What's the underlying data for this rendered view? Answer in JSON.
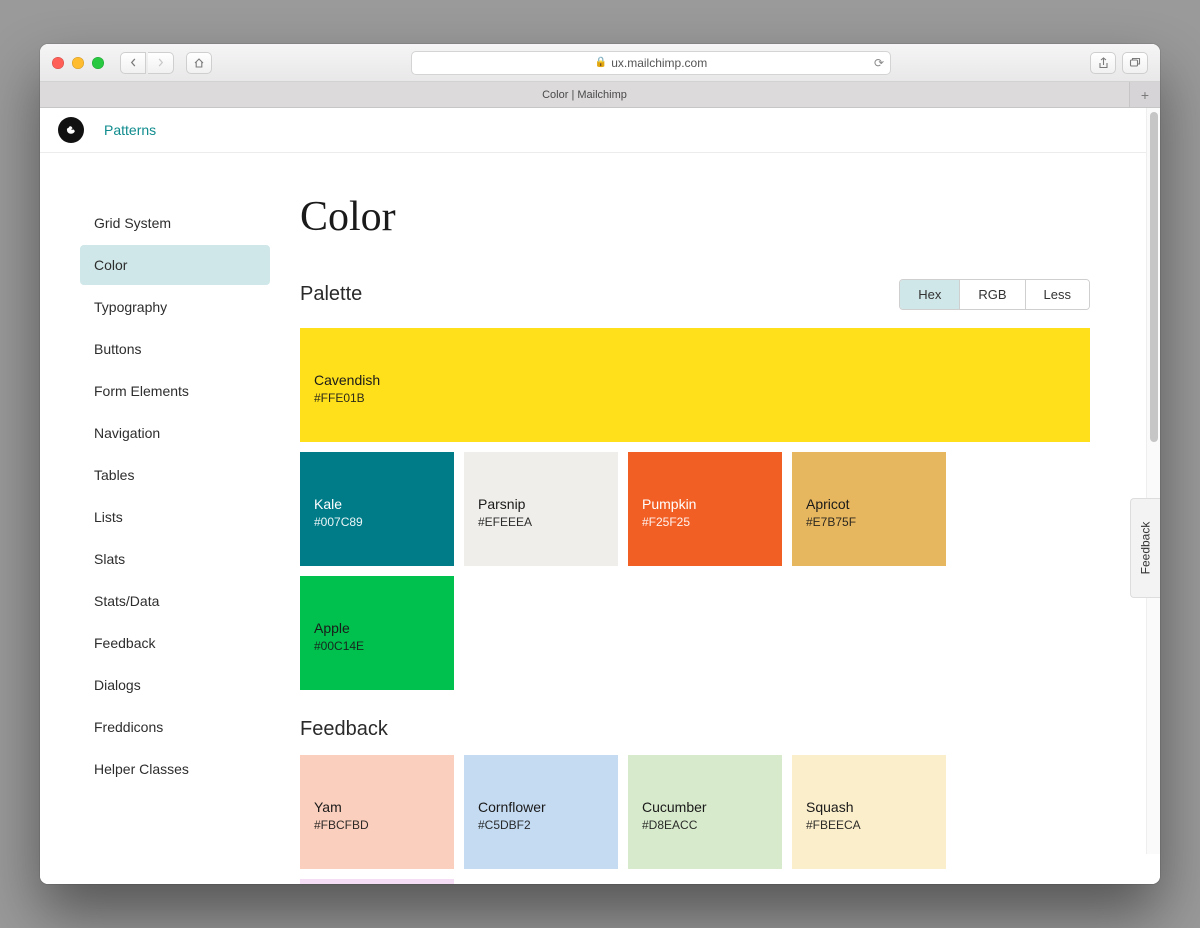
{
  "browser": {
    "url": "ux.mailchimp.com",
    "tab_title": "Color | Mailchimp"
  },
  "header": {
    "nav_link": "Patterns"
  },
  "sidebar": {
    "items": [
      {
        "label": "Grid System",
        "active": false
      },
      {
        "label": "Color",
        "active": true
      },
      {
        "label": "Typography",
        "active": false
      },
      {
        "label": "Buttons",
        "active": false
      },
      {
        "label": "Form Elements",
        "active": false
      },
      {
        "label": "Navigation",
        "active": false
      },
      {
        "label": "Tables",
        "active": false
      },
      {
        "label": "Lists",
        "active": false
      },
      {
        "label": "Slats",
        "active": false
      },
      {
        "label": "Stats/Data",
        "active": false
      },
      {
        "label": "Feedback",
        "active": false
      },
      {
        "label": "Dialogs",
        "active": false
      },
      {
        "label": "Freddicons",
        "active": false
      },
      {
        "label": "Helper Classes",
        "active": false
      }
    ]
  },
  "main": {
    "title": "Color",
    "section_palette": "Palette",
    "section_feedback": "Feedback",
    "format_toggle": [
      "Hex",
      "RGB",
      "Less"
    ],
    "format_active": "Hex",
    "palette": [
      {
        "name": "Cavendish",
        "hex": "#FFE01B",
        "bg": "#FFE01B",
        "text": "light",
        "full": true
      },
      {
        "name": "Kale",
        "hex": "#007C89",
        "bg": "#007C89",
        "text": "dark"
      },
      {
        "name": "Parsnip",
        "hex": "#EFEEEA",
        "bg": "#EFEEEA",
        "text": "light"
      },
      {
        "name": "Pumpkin",
        "hex": "#F25F25",
        "bg": "#F25F25",
        "text": "dark"
      },
      {
        "name": "Apricot",
        "hex": "#E7B75F",
        "bg": "#E7B75F",
        "text": "light"
      },
      {
        "name": "Apple",
        "hex": "#00C14E",
        "bg": "#00C14E",
        "text": "light"
      }
    ],
    "feedback_colors": [
      {
        "name": "Yam",
        "hex": "#FBCFBD",
        "bg": "#FBCFBD",
        "text": "light"
      },
      {
        "name": "Cornflower",
        "hex": "#C5DBF2",
        "bg": "#C5DBF2",
        "text": "light"
      },
      {
        "name": "Cucumber",
        "hex": "#D8EACC",
        "bg": "#D8EACC",
        "text": "light"
      },
      {
        "name": "Squash",
        "hex": "#FBEECA",
        "bg": "#FBEECA",
        "text": "light"
      },
      {
        "name": "",
        "hex": "",
        "bg": "#F6DDF6",
        "text": "light",
        "partial": true
      }
    ]
  },
  "feedback_tab": "Feedback"
}
